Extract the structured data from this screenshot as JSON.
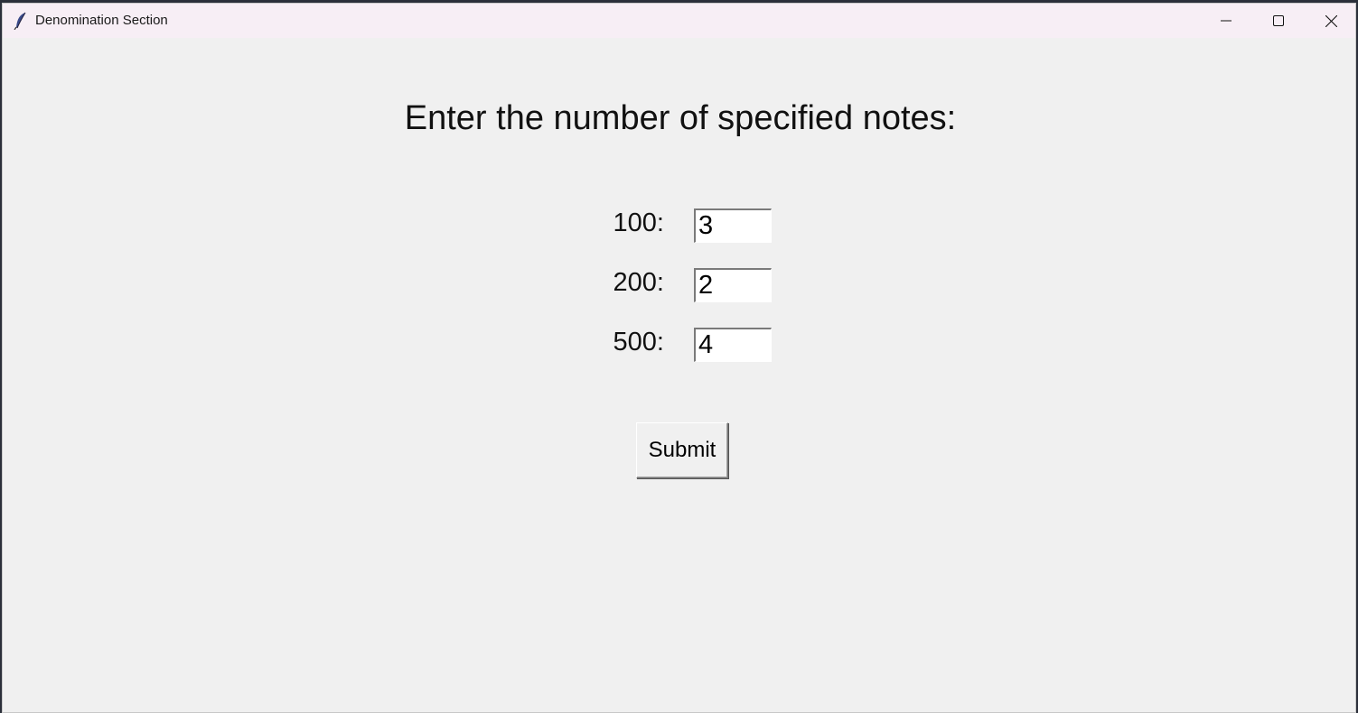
{
  "window": {
    "title": "Denomination Section",
    "icon": "feather-icon",
    "controls": [
      "minimize-icon",
      "maximize-icon",
      "close-icon"
    ]
  },
  "form": {
    "heading": "Enter the number of specified notes:",
    "rows": [
      {
        "label": "100:",
        "value": "3"
      },
      {
        "label": "200:",
        "value": "2"
      },
      {
        "label": "500:",
        "value": "4"
      }
    ],
    "submit_label": "Submit"
  },
  "colors": {
    "titlebar": "#f7eef5",
    "background": "#f0f0f0",
    "entry_background": "#ffffff"
  }
}
